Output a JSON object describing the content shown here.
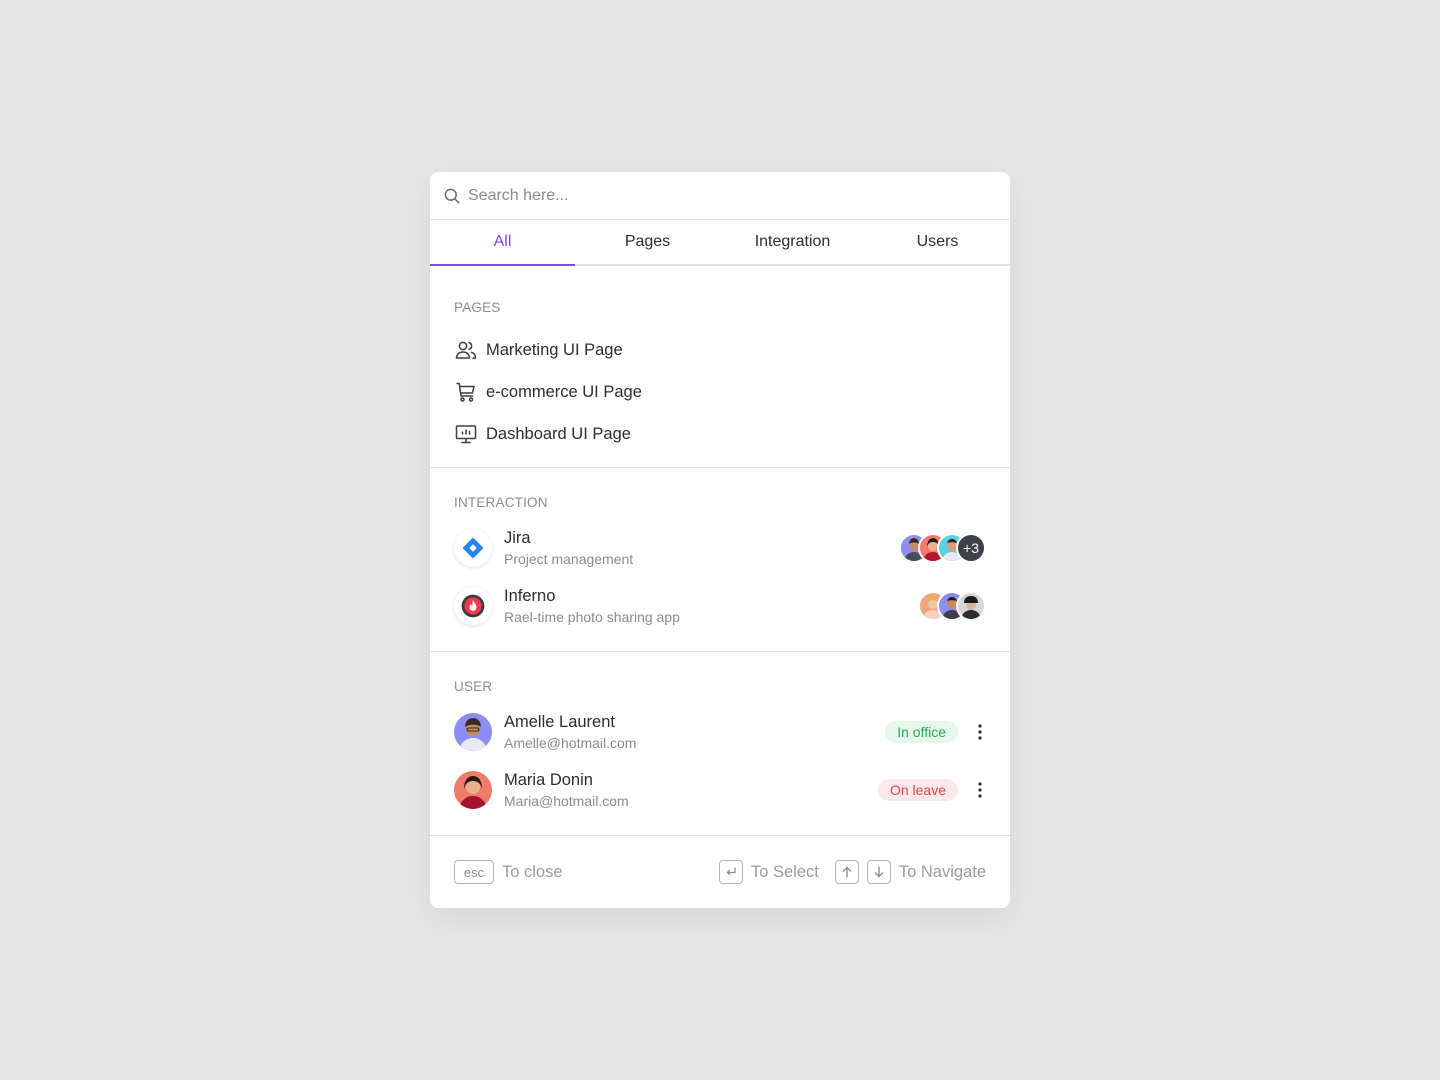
{
  "search": {
    "placeholder": "Search here..."
  },
  "tabs": [
    {
      "label": "All",
      "active": true
    },
    {
      "label": "Pages",
      "active": false
    },
    {
      "label": "Integration",
      "active": false
    },
    {
      "label": "Users",
      "active": false
    }
  ],
  "pages": {
    "title": "PAGES",
    "items": [
      {
        "label": "Marketing UI Page",
        "icon": "users-icon"
      },
      {
        "label": "e-commerce UI Page",
        "icon": "cart-icon"
      },
      {
        "label": "Dashboard UI Page",
        "icon": "monitor-icon"
      }
    ]
  },
  "interaction": {
    "title": "INTERACTION",
    "items": [
      {
        "name": "Jira",
        "description": "Project management",
        "icon": "jira-logo-icon",
        "more_count": "+3"
      },
      {
        "name": "Inferno",
        "description": "Rael-time photo sharing app",
        "icon": "inferno-logo-icon"
      }
    ]
  },
  "user": {
    "title": "USER",
    "items": [
      {
        "name": "Amelle Laurent",
        "email": "Amelle@hotmail.com",
        "status": "In office",
        "status_color": "#27a85a"
      },
      {
        "name": "Maria Donin",
        "email": "Maria@hotmail.com",
        "status": "On leave",
        "status_color": "#e0464f"
      }
    ]
  },
  "footer": {
    "esc_key": "esc",
    "close_hint": "To close",
    "select_hint": "To Select",
    "navigate_hint": "To Navigate"
  },
  "colors": {
    "accent": "#7a4ae6",
    "background": "#e5e5e5"
  }
}
